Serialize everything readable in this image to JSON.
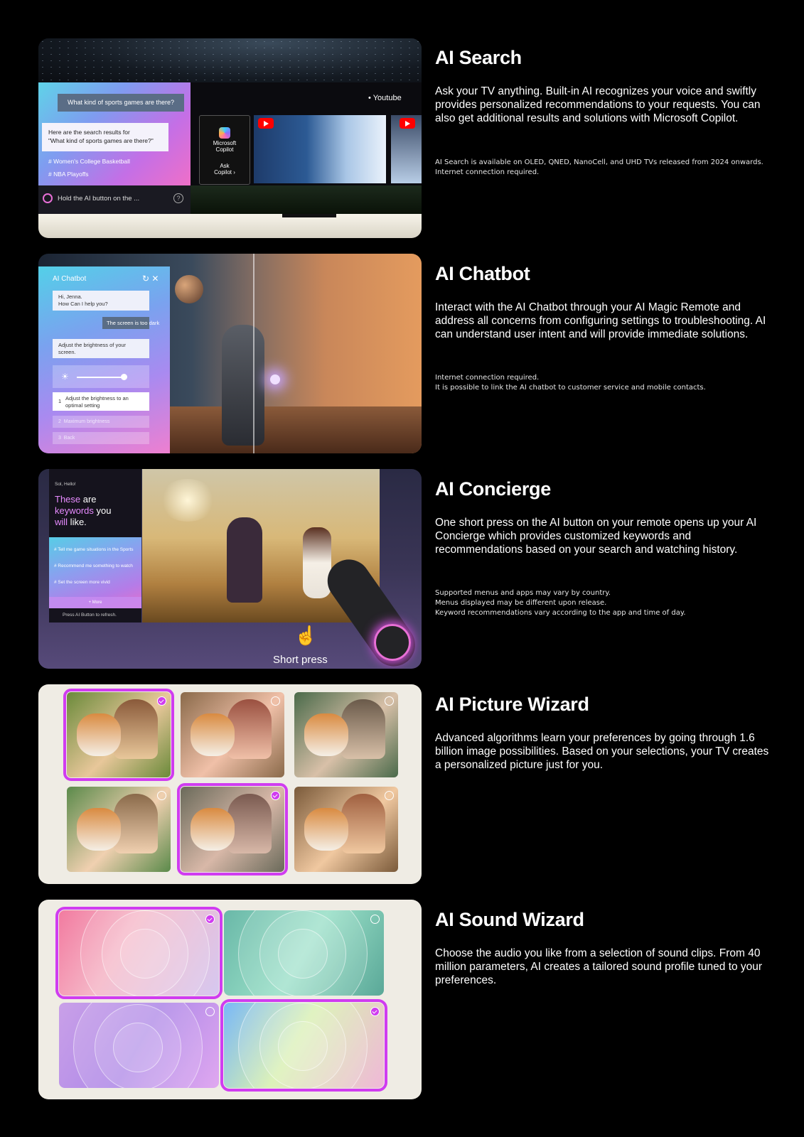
{
  "sections": [
    {
      "title": "AI Search",
      "description": "Ask your TV anything. Built-in AI recognizes your voice and swiftly provides personalized recommendations to your requests. You can also get additional results and solutions with Microsoft Copilot.",
      "notes": [
        "AI Search is available on OLED, QNED, NanoCell, and UHD TVs released from 2024 onwards.",
        "Internet connection required."
      ]
    },
    {
      "title": "AI Chatbot",
      "description": "Interact with the AI Chatbot through your AI Magic Remote and address all concerns from configuring settings to troubleshooting. AI can understand user intent and will provide immediate solutions.",
      "notes": [
        "Internet connection required.",
        "It is possible to link the AI chatbot to customer service and mobile contacts."
      ]
    },
    {
      "title": "AI Concierge",
      "description": "One short press on the AI button on your remote opens up your AI Concierge which provides customized keywords and recommendations based on your search and watching history.",
      "notes": [
        "Supported menus and apps may vary by country.",
        "Menus displayed may be different upon release.",
        "Keyword recommendations vary according to the app and time of day."
      ]
    },
    {
      "title": "AI Picture Wizard",
      "description": "Advanced algorithms learn your preferences by going through 1.6 billion image possibilities. Based on your selections, your TV creates a personalized picture just for you.",
      "notes": []
    },
    {
      "title": "AI Sound Wizard",
      "description": "Choose the audio you like from a selection of sound clips. From 40 million parameters, AI creates a tailored sound profile tuned to your preferences.",
      "notes": []
    }
  ],
  "search_panel": {
    "question": "What kind of sports games are there?",
    "answer_line1": "Here are the search results for",
    "answer_line2": "\"What kind of sports games are there?\"",
    "tags": [
      "# Women's College Basketball",
      "# NBA Playoffs"
    ],
    "hold_text": "Hold the AI button on the ...",
    "help_icon": "?",
    "youtube_label": "Youtube",
    "copilot_name_1": "Microsoft",
    "copilot_name_2": "Copilot",
    "copilot_action_1": "Ask",
    "copilot_action_2": "Copilot"
  },
  "chatbot_panel": {
    "title": "AI Chatbot",
    "greeting_1": "Hi, Jenna.",
    "greeting_2": "How Can I help you?",
    "user_msg": "The screen is too dark",
    "reply": "Adjust the brightness of your screen.",
    "options": [
      {
        "num": "1",
        "label": "Adjust the brightness to an optimal setting"
      },
      {
        "num": "2",
        "label": "Maximum brightness"
      },
      {
        "num": "3",
        "label": "Back"
      }
    ]
  },
  "concierge_panel": {
    "hello": "Sol, Hello!",
    "headline_hl1": "These",
    "headline_1": " are",
    "headline_hl2": "keywords",
    "headline_2": " you",
    "headline_hl3": "will",
    "headline_3": " like.",
    "keywords": [
      "# Tell me game situations in the Sports",
      "# Recommend me something to watch",
      "# Set the screen more vivid"
    ],
    "more": "+ More",
    "press_text": "Press AI Button to refresh.",
    "short_press": "Short press"
  },
  "picture_wizard": {
    "selected": [
      true,
      false,
      false,
      false,
      true,
      false
    ]
  },
  "sound_wizard": {
    "selected": [
      true,
      false,
      false,
      true
    ]
  }
}
